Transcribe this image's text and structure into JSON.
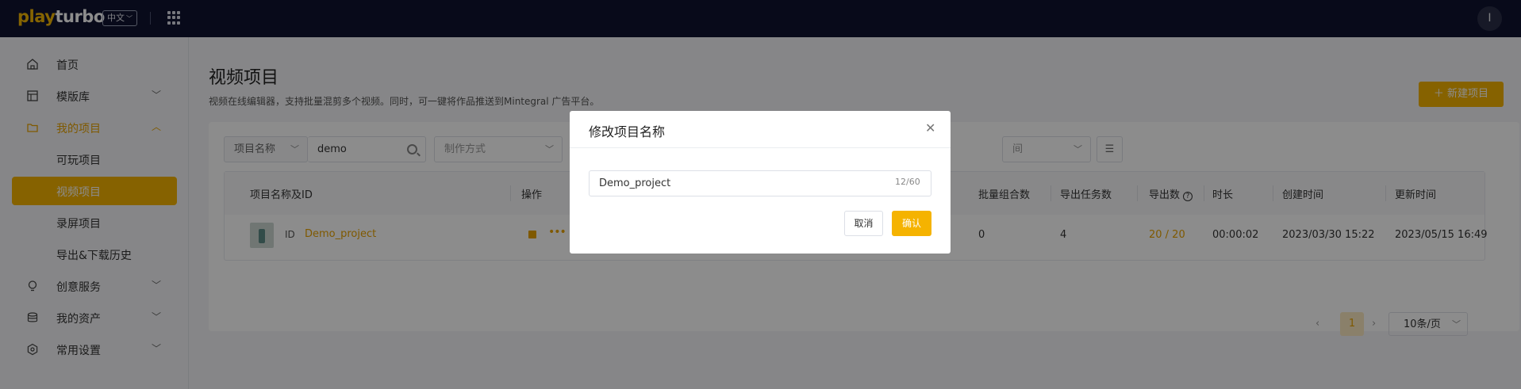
{
  "topbar": {
    "logo_part1": "play",
    "logo_part2": "turbo",
    "lang": "中文",
    "avatar_initial": "I"
  },
  "sidebar": {
    "items": [
      {
        "label": "首页",
        "icon": "home-icon"
      },
      {
        "label": "模版库",
        "icon": "template-icon"
      },
      {
        "label": "我的项目",
        "icon": "folder-icon"
      },
      {
        "label": "可玩项目"
      },
      {
        "label": "视频项目"
      },
      {
        "label": "录屏项目"
      },
      {
        "label": "导出&下载历史"
      },
      {
        "label": "创意服务",
        "icon": "lightbulb-icon"
      },
      {
        "label": "我的资产",
        "icon": "database-icon"
      },
      {
        "label": "常用设置",
        "icon": "settings-icon"
      }
    ]
  },
  "main": {
    "title": "视频项目",
    "description": "视频在线编辑器，支持批量混剪多个视频。同时，可一键将作品推送到Mintegral 广告平台。",
    "new_button": "＋ 新建项目",
    "filters": {
      "field_label": "项目名称",
      "search_value": "demo",
      "method_placeholder": "制作方式",
      "time_placeholder": "间"
    },
    "table": {
      "headers": [
        "项目名称及ID",
        "操作",
        "批量组合数",
        "导出任务数",
        "导出数",
        "时长",
        "创建时间",
        "更新时间"
      ],
      "row": {
        "id_tag": "ID",
        "name": "Demo_project",
        "combos": "0",
        "tasks": "4",
        "exports": "20 / 20",
        "duration": "00:00:02",
        "created": "2023/03/30 15:22",
        "updated": "2023/05/15 16:49"
      }
    },
    "pagination": {
      "current": "1",
      "page_size": "10条/页"
    }
  },
  "modal": {
    "title": "修改项目名称",
    "input_value": "Demo_project",
    "char_count": "12/60",
    "cancel": "取消",
    "confirm": "确认"
  },
  "colors": {
    "accent": "#f5b300",
    "topbar": "#0f1330"
  }
}
